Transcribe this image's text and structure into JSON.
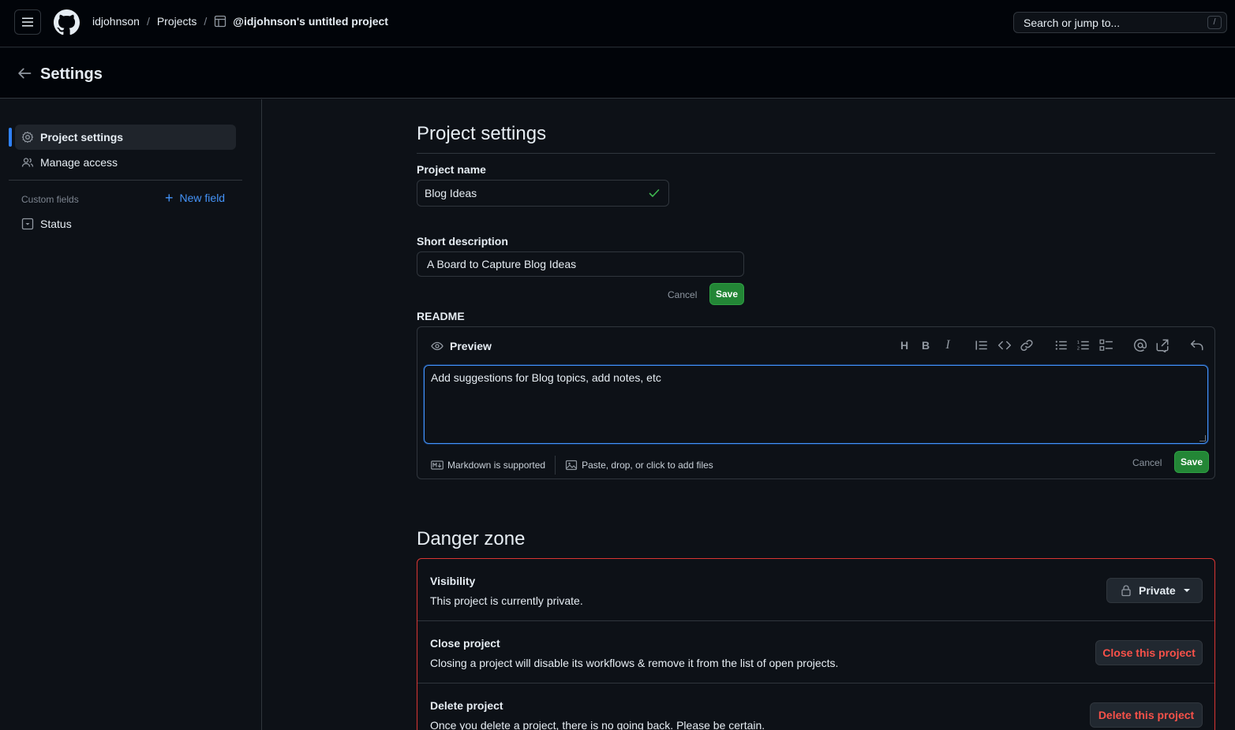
{
  "header": {
    "breadcrumb": {
      "owner": "idjohnson",
      "section": "Projects",
      "project": "@idjohnson's untitled project"
    },
    "search_placeholder": "Search or jump to...",
    "search_shortcut": "/"
  },
  "settings_bar": {
    "title": "Settings"
  },
  "sidebar": {
    "items": [
      {
        "label": "Project settings",
        "active": true,
        "icon": "gear-icon"
      },
      {
        "label": "Manage access",
        "active": false,
        "icon": "people-icon"
      }
    ],
    "custom_fields_label": "Custom fields",
    "new_field_label": "New field",
    "fields": [
      {
        "label": "Status",
        "icon": "single-select-icon"
      }
    ]
  },
  "main": {
    "title": "Project settings",
    "project_name": {
      "label": "Project name",
      "value": "Blog Ideas"
    },
    "short_description": {
      "label": "Short description",
      "value": "A Board to Capture Blog Ideas",
      "cancel": "Cancel",
      "save": "Save"
    },
    "readme": {
      "label": "README",
      "preview": "Preview",
      "content": "Add suggestions for Blog topics, add notes, etc",
      "markdown_note": "Markdown is supported",
      "files_note": "Paste, drop, or click to add files",
      "cancel": "Cancel",
      "save": "Save"
    },
    "danger_zone": {
      "title": "Danger zone",
      "visibility": {
        "heading": "Visibility",
        "description": "This project is currently private.",
        "button": "Private"
      },
      "close": {
        "heading": "Close project",
        "description": "Closing a project will disable its workflows & remove it from the list of open projects.",
        "button": "Close this project"
      },
      "delete": {
        "heading": "Delete project",
        "description": "Once you delete a project, there is no going back. Please be certain.",
        "button": "Delete this project"
      }
    }
  },
  "colors": {
    "accent": "#2f81f7",
    "success": "#238636",
    "danger": "#f85149",
    "background": "#0d1117"
  }
}
